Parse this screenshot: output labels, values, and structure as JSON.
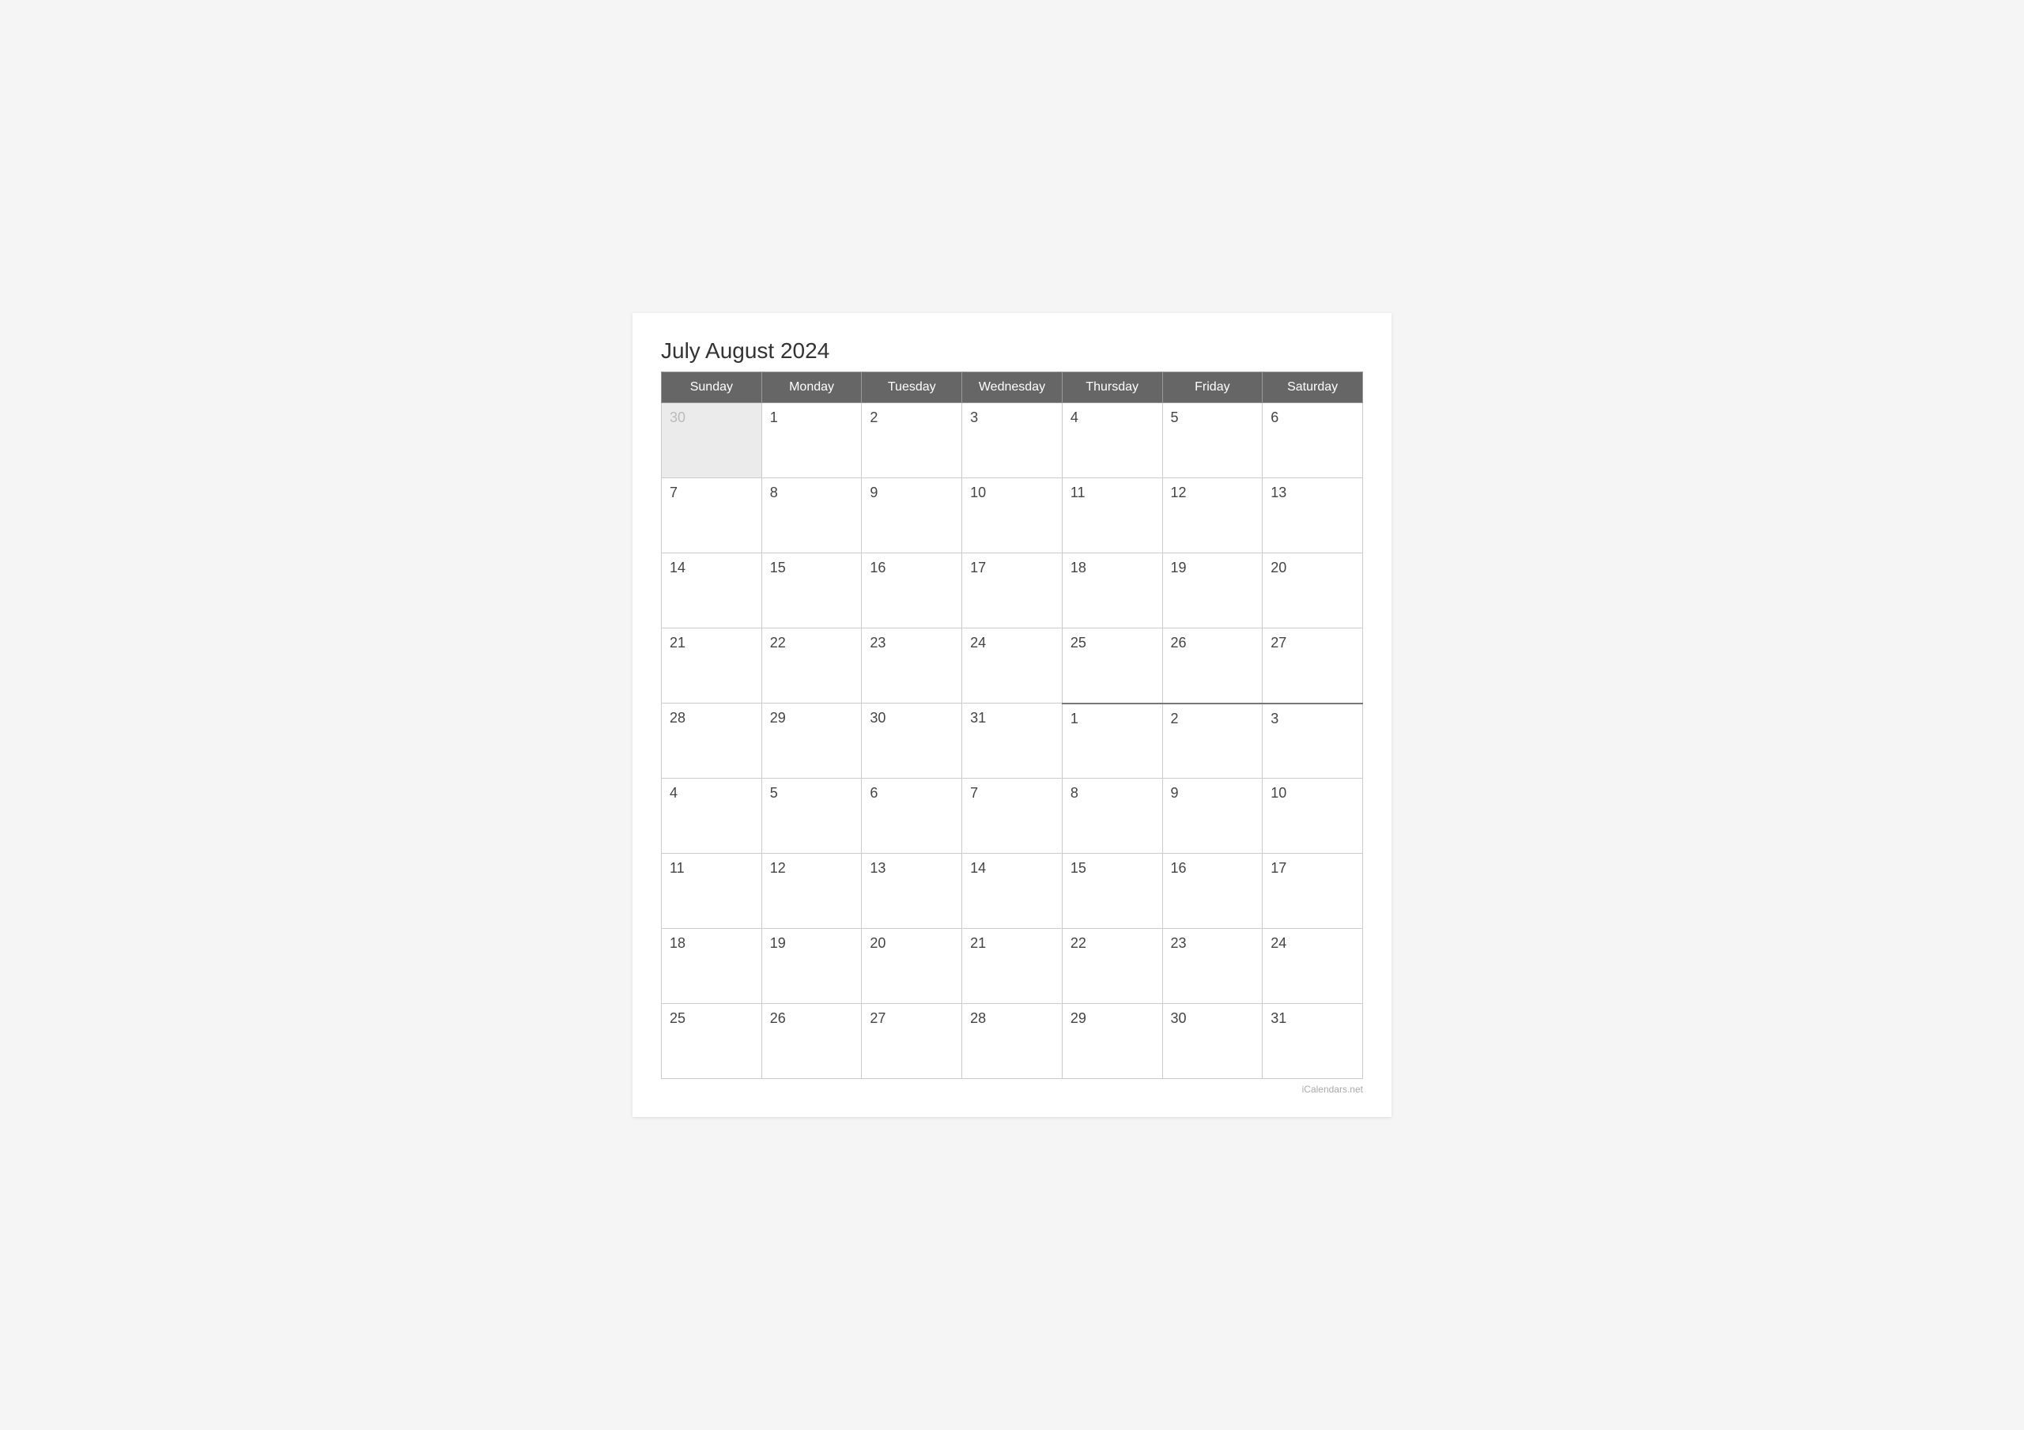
{
  "title": "July August 2024",
  "watermark": "iCalendars.net",
  "headers": [
    "Sunday",
    "Monday",
    "Tuesday",
    "Wednesday",
    "Thursday",
    "Friday",
    "Saturday"
  ],
  "rows": [
    [
      {
        "day": "30",
        "type": "prev-month"
      },
      {
        "day": "1",
        "type": "current"
      },
      {
        "day": "2",
        "type": "current"
      },
      {
        "day": "3",
        "type": "current"
      },
      {
        "day": "4",
        "type": "current"
      },
      {
        "day": "5",
        "type": "current"
      },
      {
        "day": "6",
        "type": "current"
      }
    ],
    [
      {
        "day": "7",
        "type": "current"
      },
      {
        "day": "8",
        "type": "current"
      },
      {
        "day": "9",
        "type": "current"
      },
      {
        "day": "10",
        "type": "current"
      },
      {
        "day": "11",
        "type": "current"
      },
      {
        "day": "12",
        "type": "current"
      },
      {
        "day": "13",
        "type": "current"
      }
    ],
    [
      {
        "day": "14",
        "type": "current"
      },
      {
        "day": "15",
        "type": "current"
      },
      {
        "day": "16",
        "type": "current"
      },
      {
        "day": "17",
        "type": "current"
      },
      {
        "day": "18",
        "type": "current"
      },
      {
        "day": "19",
        "type": "current"
      },
      {
        "day": "20",
        "type": "current"
      }
    ],
    [
      {
        "day": "21",
        "type": "current"
      },
      {
        "day": "22",
        "type": "current"
      },
      {
        "day": "23",
        "type": "current"
      },
      {
        "day": "24",
        "type": "current"
      },
      {
        "day": "25",
        "type": "current"
      },
      {
        "day": "26",
        "type": "current"
      },
      {
        "day": "27",
        "type": "current"
      }
    ],
    [
      {
        "day": "28",
        "type": "current"
      },
      {
        "day": "29",
        "type": "current"
      },
      {
        "day": "30",
        "type": "current"
      },
      {
        "day": "31",
        "type": "current"
      },
      {
        "day": "1",
        "type": "august-start"
      },
      {
        "day": "2",
        "type": "august-start"
      },
      {
        "day": "3",
        "type": "august-start"
      }
    ],
    [
      {
        "day": "4",
        "type": "current"
      },
      {
        "day": "5",
        "type": "current"
      },
      {
        "day": "6",
        "type": "current"
      },
      {
        "day": "7",
        "type": "current"
      },
      {
        "day": "8",
        "type": "current"
      },
      {
        "day": "9",
        "type": "current"
      },
      {
        "day": "10",
        "type": "current"
      }
    ],
    [
      {
        "day": "11",
        "type": "current"
      },
      {
        "day": "12",
        "type": "current"
      },
      {
        "day": "13",
        "type": "current"
      },
      {
        "day": "14",
        "type": "current"
      },
      {
        "day": "15",
        "type": "current"
      },
      {
        "day": "16",
        "type": "current"
      },
      {
        "day": "17",
        "type": "current"
      }
    ],
    [
      {
        "day": "18",
        "type": "current"
      },
      {
        "day": "19",
        "type": "current"
      },
      {
        "day": "20",
        "type": "current"
      },
      {
        "day": "21",
        "type": "current"
      },
      {
        "day": "22",
        "type": "current"
      },
      {
        "day": "23",
        "type": "current"
      },
      {
        "day": "24",
        "type": "current"
      }
    ],
    [
      {
        "day": "25",
        "type": "current"
      },
      {
        "day": "26",
        "type": "current"
      },
      {
        "day": "27",
        "type": "current"
      },
      {
        "day": "28",
        "type": "current"
      },
      {
        "day": "29",
        "type": "current"
      },
      {
        "day": "30",
        "type": "current"
      },
      {
        "day": "31",
        "type": "current"
      }
    ]
  ]
}
